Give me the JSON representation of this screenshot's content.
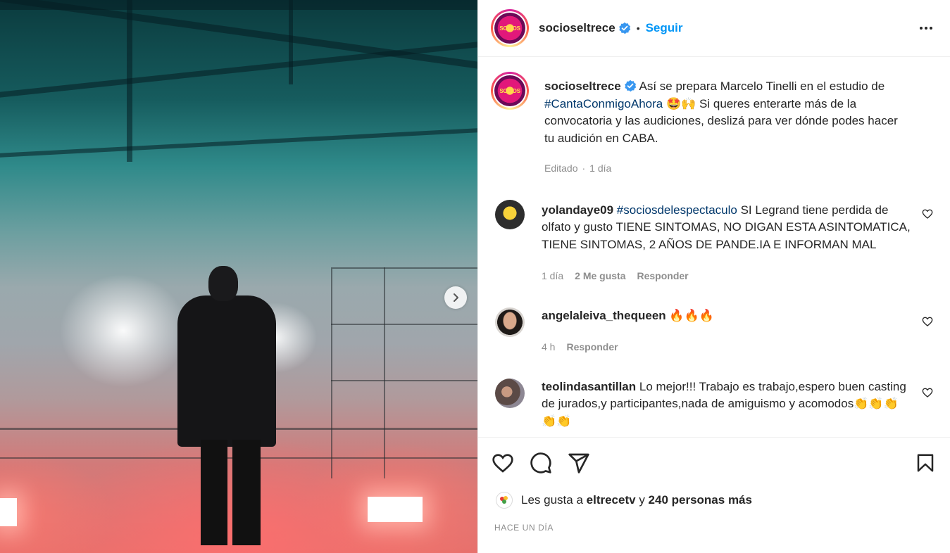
{
  "post_image": {
    "next_button_icon": "chevron-right-icon"
  },
  "header": {
    "username": "socioseltrece",
    "separator": "•",
    "follow_label": "Seguir",
    "more_icon": "more-horizontal-icon",
    "avatar_text": "SOCIOS"
  },
  "caption": {
    "username": "socioseltrece",
    "text_1": "Así se prepara Marcelo Tinelli en el estudio de",
    "hashtag": "#CantaConmigoAhora",
    "emojis": "🤩🙌",
    "text_2": "Si queres enterarte más de la convocatoria y las audiciones, deslizá para ver dónde podes hacer tu audición en CABA.",
    "meta_edited": "Editado",
    "meta_separator": "·",
    "meta_time": "1 día"
  },
  "comments": [
    {
      "username": "yolandaye09",
      "hashtag": "#sociosdelespectaculo",
      "text": "SI Legrand tiene perdida de olfato y gusto TIENE SINTOMAS, NO DIGAN ESTA ASINTOMATICA, TIENE SINTOMAS, 2 AÑOS DE PANDE.IA E INFORMAN MAL",
      "time": "1 día",
      "likes": "2 Me gusta",
      "reply": "Responder"
    },
    {
      "username": "angelaleiva_thequeen",
      "text": "🔥🔥🔥",
      "time": "4 h",
      "reply": "Responder"
    },
    {
      "username": "teolindasantillan",
      "text": "Lo mejor!!! Trabajo es trabajo,espero buen casting de jurados,y participantes,nada de amiguismo y acomodos👏👏👏👏👏"
    }
  ],
  "actions": {
    "like_icon": "heart-icon",
    "comment_icon": "comment-icon",
    "share_icon": "send-icon",
    "save_icon": "bookmark-icon"
  },
  "likes": {
    "prefix": "Les gusta a",
    "user": "eltrecetv",
    "connector": "y",
    "others": "240 personas más"
  },
  "date": "HACE UN DÍA",
  "colors": {
    "link_blue": "#0095f6",
    "hashtag_blue": "#00376b",
    "muted_text": "#8e8e8e",
    "verified_blue": "#3897f0"
  }
}
